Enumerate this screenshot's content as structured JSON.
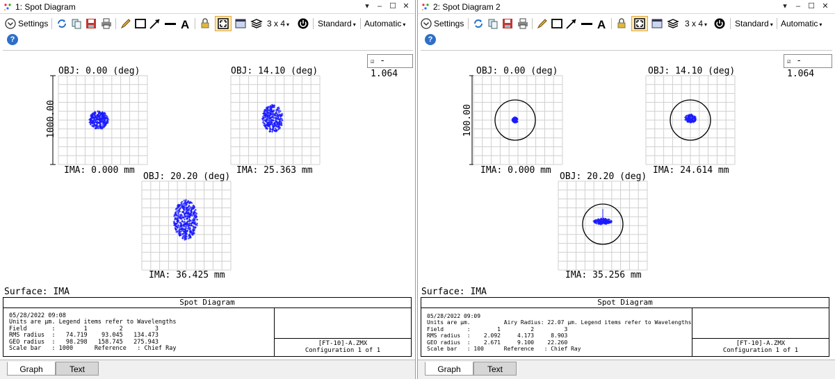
{
  "windows": [
    {
      "title": "1: Spot Diagram",
      "toolbar": {
        "settings": "Settings",
        "layout": "3 x 4",
        "standard": "Standard",
        "automatic": "Automatic"
      },
      "badge": "1.064",
      "scale_bar_label": "1000.00",
      "plots": [
        {
          "obj": "OBJ: 0.00 (deg)",
          "ima": "IMA: 0.000 mm"
        },
        {
          "obj": "OBJ: 14.10 (deg)",
          "ima": "IMA: 25.363 mm"
        },
        {
          "obj": "OBJ: 20.20 (deg)",
          "ima": "IMA: 36.425 mm"
        }
      ],
      "surface": "Surface: IMA",
      "info_title": "Spot Diagram",
      "info_lines": "05/28/2022 09:08\nUnits are µm. Legend items refer to Wavelengths\nField       :        1         2         3\nRMS radius  :   74.719    93.045   134.473\nGEO radius  :   98.298   158.745   275.943\nScale bar   : 1000      Reference   : Chief Ray",
      "file": "[FT-10]-A.ZMX",
      "config": "Configuration 1 of 1",
      "tabs": [
        "Graph",
        "Text"
      ]
    },
    {
      "title": "2: Spot Diagram 2",
      "toolbar": {
        "settings": "Settings",
        "layout": "3 x 4",
        "standard": "Standard",
        "automatic": "Automatic"
      },
      "badge": "1.064",
      "scale_bar_label": "100.00",
      "plots": [
        {
          "obj": "OBJ: 0.00 (deg)",
          "ima": "IMA: 0.000 mm"
        },
        {
          "obj": "OBJ: 14.10 (deg)",
          "ima": "IMA: 24.614 mm"
        },
        {
          "obj": "OBJ: 20.20 (deg)",
          "ima": "IMA: 35.256 mm"
        }
      ],
      "surface": "Surface: IMA",
      "info_title": "Spot Diagram",
      "info_lines": "05/28/2022 09:09\nUnits are µm.          Airy Radius: 22.07 µm. Legend items refer to Wavelengths\nField       :        1         2         3\nRMS radius  :    2.092     4.173     8.903\nGEO radius  :    2.671     9.100    22.260\nScale bar   : 100      Reference   : Chief Ray",
      "file": "[FT-10]-A.ZMX",
      "config": "Configuration 1 of 1",
      "tabs": [
        "Graph",
        "Text"
      ]
    }
  ],
  "colors": {
    "spot": "#1a1aff",
    "grid": "#cfcfcf",
    "selected": "#fde9b5"
  }
}
